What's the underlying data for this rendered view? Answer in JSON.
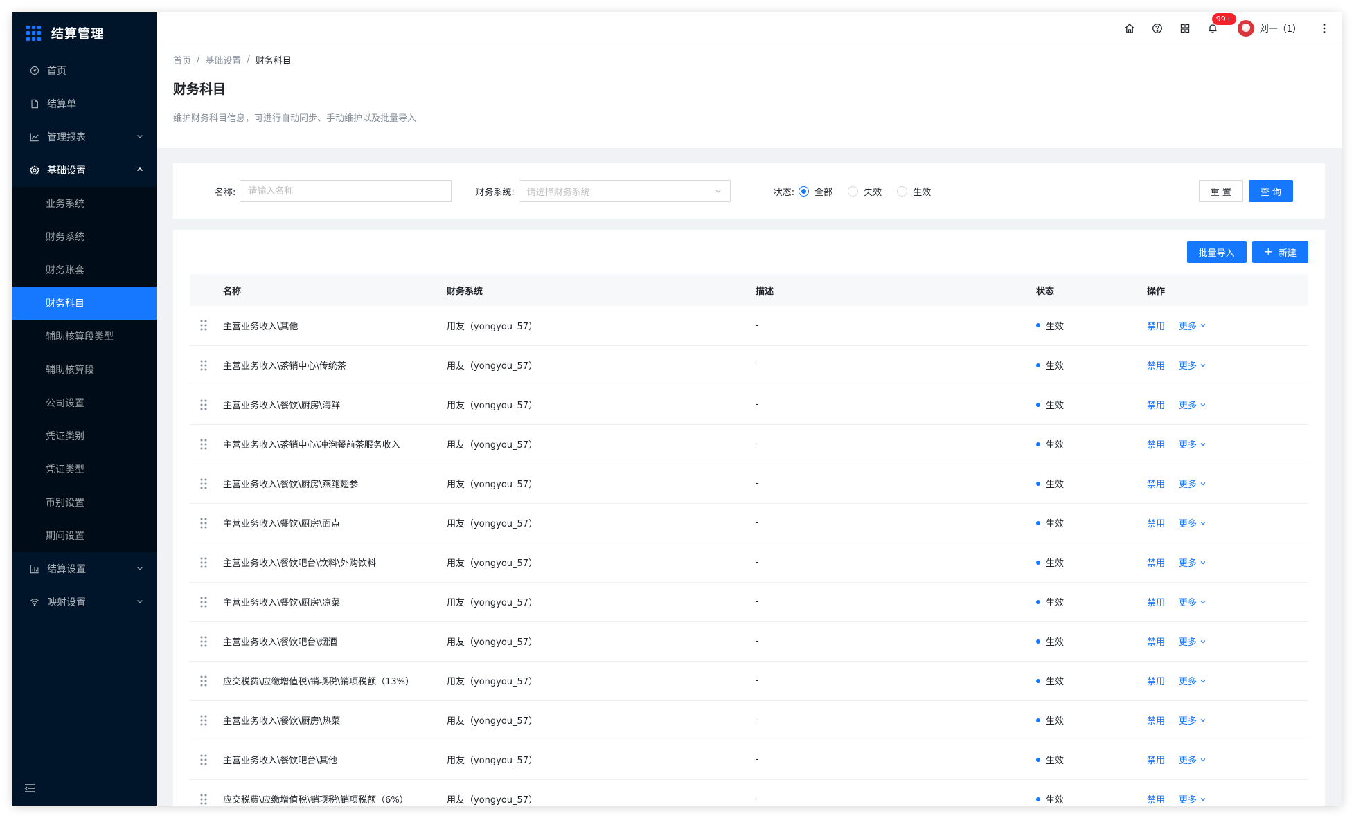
{
  "app": {
    "title": "结算管理"
  },
  "sidebar": {
    "items": [
      {
        "label": "首页",
        "icon": "dashboard-icon"
      },
      {
        "label": "结算单",
        "icon": "file-icon"
      },
      {
        "label": "管理报表",
        "icon": "line-chart-icon"
      },
      {
        "label": "基础设置",
        "icon": "gear-icon"
      },
      {
        "label": "结算设置",
        "icon": "bar-chart-icon"
      },
      {
        "label": "映射设置",
        "icon": "wifi-icon"
      }
    ],
    "submenu": [
      "业务系统",
      "财务系统",
      "财务账套",
      "财务科目",
      "辅助核算段类型",
      "辅助核算段",
      "公司设置",
      "凭证类别",
      "凭证类型",
      "币别设置",
      "期间设置"
    ],
    "active_sub": "财务科目"
  },
  "topbar": {
    "badge": "99+",
    "user": "刘一（1）"
  },
  "header": {
    "breadcrumb": [
      "首页",
      "基础设置",
      "财务科目"
    ],
    "title": "财务科目",
    "description": "维护财务科目信息，可进行自动同步、手动维护以及批量导入"
  },
  "filter": {
    "name_label": "名称:",
    "name_placeholder": "请输入名称",
    "system_label": "财务系统:",
    "system_placeholder": "请选择财务系统",
    "status_label": "状态:",
    "status_options": [
      "全部",
      "失效",
      "生效"
    ],
    "status_selected": "全部",
    "reset_label": "重 置",
    "query_label": "查 询"
  },
  "toolbar": {
    "import_label": "批量导入",
    "new_label": "新建"
  },
  "table": {
    "columns": [
      "名称",
      "财务系统",
      "描述",
      "状态",
      "操作"
    ],
    "rows": [
      {
        "name": "主营业务收入\\其他",
        "system": "用友（yongyou_57）",
        "desc": "-",
        "status": "生效"
      },
      {
        "name": "主营业务收入\\茶销中心\\传统茶",
        "system": "用友（yongyou_57）",
        "desc": "-",
        "status": "生效"
      },
      {
        "name": "主营业务收入\\餐饮\\厨房\\海鲜",
        "system": "用友（yongyou_57）",
        "desc": "-",
        "status": "生效"
      },
      {
        "name": "主营业务收入\\茶销中心\\冲泡餐前茶服务收入",
        "system": "用友（yongyou_57）",
        "desc": "-",
        "status": "生效"
      },
      {
        "name": "主营业务收入\\餐饮\\厨房\\燕鲍翅参",
        "system": "用友（yongyou_57）",
        "desc": "-",
        "status": "生效"
      },
      {
        "name": "主营业务收入\\餐饮\\厨房\\面点",
        "system": "用友（yongyou_57）",
        "desc": "-",
        "status": "生效"
      },
      {
        "name": "主营业务收入\\餐饮吧台\\饮料\\外购饮料",
        "system": "用友（yongyou_57）",
        "desc": "-",
        "status": "生效"
      },
      {
        "name": "主营业务收入\\餐饮\\厨房\\凉菜",
        "system": "用友（yongyou_57）",
        "desc": "-",
        "status": "生效"
      },
      {
        "name": "主营业务收入\\餐饮吧台\\烟酒",
        "system": "用友（yongyou_57）",
        "desc": "-",
        "status": "生效"
      },
      {
        "name": "应交税费\\应缴增值税\\销项税\\销项税额（13%）",
        "system": "用友（yongyou_57）",
        "desc": "-",
        "status": "生效"
      },
      {
        "name": "主营业务收入\\餐饮\\厨房\\热菜",
        "system": "用友（yongyou_57）",
        "desc": "-",
        "status": "生效"
      },
      {
        "name": "主营业务收入\\餐饮吧台\\其他",
        "system": "用友（yongyou_57）",
        "desc": "-",
        "status": "生效"
      },
      {
        "name": "应交税费\\应缴增值税\\销项税\\销项税额（6%）",
        "system": "用友（yongyou_57）",
        "desc": "-",
        "status": "生效"
      }
    ],
    "op_disable": "禁用",
    "op_more": "更多"
  },
  "colors": {
    "primary": "#1677ff",
    "sidebar_bg": "#001529",
    "badge": "#f5222d"
  }
}
